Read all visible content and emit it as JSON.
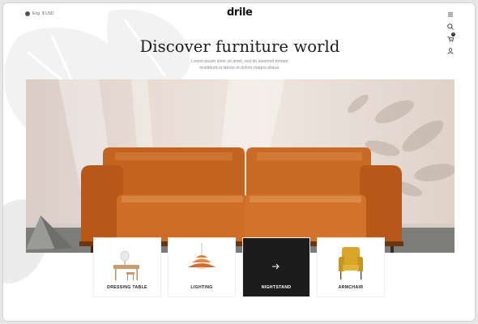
{
  "header": {
    "language": "Eng",
    "currency": "$ USD",
    "logo": "drile",
    "cart_count": "0",
    "icons": [
      "menu-icon",
      "search-icon",
      "cart-icon",
      "user-icon"
    ]
  },
  "hero": {
    "title": "Discover furniture world",
    "subtitle": "Lorem ipsum dolor sit amet, sed do eiusmod tempor incididunt ut labore et dolore magna aliqua."
  },
  "categories": [
    {
      "label": "DRESSING TABLE",
      "icon": "dressing-table-icon",
      "active": false
    },
    {
      "label": "LIGHTING",
      "icon": "pendant-lamp-icon",
      "active": false
    },
    {
      "label": "NIGHTSTAND",
      "icon": "arrow-right-icon",
      "active": true
    },
    {
      "label": "ARMCHAIR",
      "icon": "armchair-icon",
      "active": false
    }
  ],
  "colors": {
    "sofa": "#c4621f",
    "active_card": "#1c1c1c",
    "text": "#1b1b1b"
  }
}
